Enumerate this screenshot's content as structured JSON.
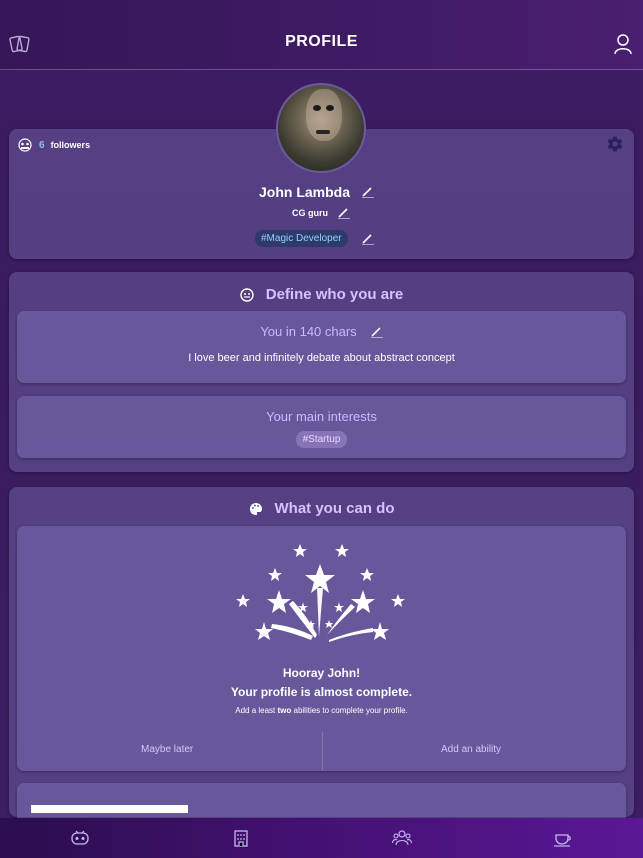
{
  "header": {
    "title": "PROFILE"
  },
  "profile": {
    "followers_count": "6",
    "followers_label": "followers",
    "name": "John Lambda",
    "role": "CG guru",
    "tag": "#Magic Developer"
  },
  "define": {
    "title": "Define who you are",
    "chars_title": "You in 140 chars",
    "bio": "I love beer and infinitely debate about abstract concept",
    "interests_title": "Your main interests",
    "interests": [
      "#Startup"
    ]
  },
  "abilities": {
    "title": "What you can do",
    "hooray": "Hooray John!",
    "almost": "Your profile is almost complete.",
    "hint_pre": "Add a least ",
    "hint_bold": "two",
    "hint_post": " abilities to complete your profile.",
    "maybe_later": "Maybe later",
    "add_ability": "Add an ability"
  },
  "colors": {
    "accent": "#d9c0ff",
    "link": "#8fb8ff",
    "tag_bg": "#2f3a6a"
  },
  "icons": {
    "header_left": "cards-icon",
    "header_right": "user-icon",
    "settings": "gear-icon",
    "nav": [
      "robot-icon",
      "building-icon",
      "group-icon",
      "coffee-icon"
    ]
  }
}
